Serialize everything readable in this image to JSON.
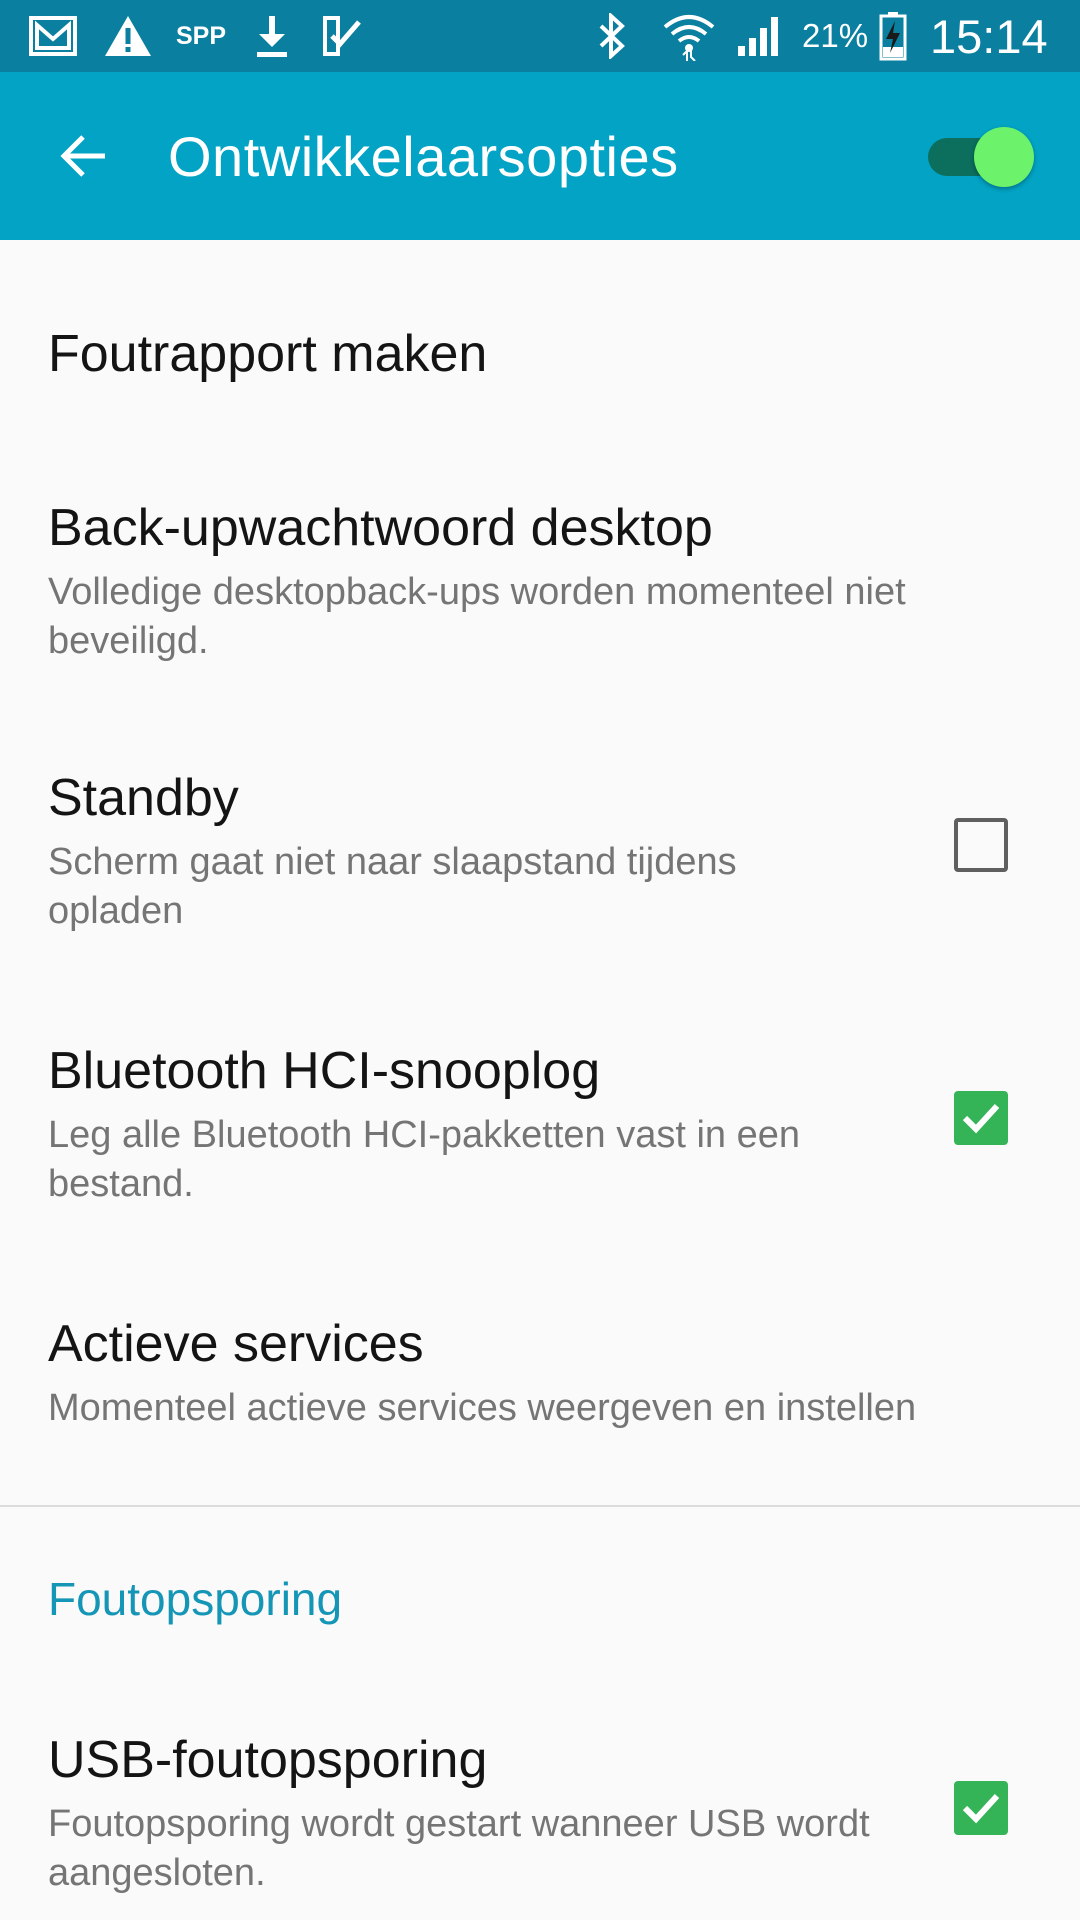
{
  "status_bar": {
    "icons": [
      "gmail-icon",
      "warning-icon",
      "spp-label",
      "download-icon",
      "checkmark-app-icon",
      "bluetooth-icon",
      "wifi-icon",
      "signal-icon",
      "battery-charging-icon"
    ],
    "spp": "SPP",
    "battery": "21%",
    "time": "15:14"
  },
  "app_bar": {
    "title": "Ontwikkelaarsopties",
    "master_switch_on": true,
    "accent_color": "#02a3c4"
  },
  "items": [
    {
      "title": "Foutrapport maken",
      "summary": "",
      "control": "none"
    },
    {
      "title": "Back-upwachtwoord desktop",
      "summary": "Volledige desktopback-ups worden momenteel niet beveiligd.",
      "control": "none"
    },
    {
      "title": "Standby",
      "summary": "Scherm gaat niet naar slaapstand tijdens opladen",
      "control": "checkbox",
      "checked": false
    },
    {
      "title": "Bluetooth HCI-snooplog",
      "summary": "Leg alle Bluetooth HCI-pakketten vast in een bestand.",
      "control": "checkbox",
      "checked": true
    },
    {
      "title": "Actieve services",
      "summary": "Momenteel actieve services weergeven en instellen",
      "control": "none"
    }
  ],
  "section": {
    "header": "Foutopsporing",
    "items": [
      {
        "title": "USB-foutopsporing",
        "summary": "Foutopsporing wordt gestart wanneer USB wordt aangesloten.",
        "control": "checkbox",
        "checked": true
      }
    ]
  },
  "colors": {
    "status_bar": "#0a7fa0",
    "checkbox_checked": "#34b457",
    "section_header": "#1596b6"
  }
}
